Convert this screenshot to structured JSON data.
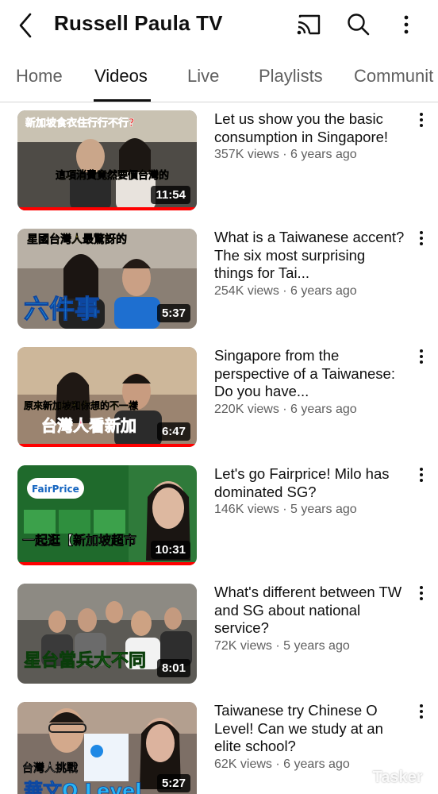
{
  "header": {
    "channel_name": "Russell Paula TV"
  },
  "tabs": [
    {
      "label": "Home"
    },
    {
      "label": "Videos"
    },
    {
      "label": "Live"
    },
    {
      "label": "Playlists"
    },
    {
      "label": "Communit"
    }
  ],
  "videos": [
    {
      "title": "Let us show you the basic consumption in Singapore!",
      "stats": "357K views · 6 years ago",
      "duration": "11:54",
      "overlay_top": "新加坡食衣住行行不行?",
      "overlay_bottom": "這項消費竟然要價台灣的"
    },
    {
      "title": "What is a Taiwanese accent?  The six most surprising things for Tai...",
      "stats": "254K views · 6 years ago",
      "duration": "5:37",
      "overlay_top": "星國台灣人最驚訝的",
      "overlay_bottom": "六件事"
    },
    {
      "title": "Singapore from the perspective of a Taiwanese: Do you have...",
      "stats": "220K views · 6 years ago",
      "duration": "6:47",
      "overlay_top": "原來新加坡和你想的不一樣",
      "overlay_bottom": "台灣人看新加"
    },
    {
      "title": "Let's go Fairprice! Milo has dominated SG?",
      "stats": "146K views · 5 years ago",
      "duration": "10:31",
      "overlay_top": "FairPrice",
      "overlay_bottom": "一起逛【新加坡超市"
    },
    {
      "title": "What's different between TW and SG about national service?",
      "stats": "72K views · 5 years ago",
      "duration": "8:01",
      "overlay_top": "",
      "overlay_bottom": "星台當兵大不同"
    },
    {
      "title": "Taiwanese try Chinese O Level! Can we study at an elite school?",
      "stats": "62K views · 6 years ago",
      "duration": "5:27",
      "overlay_top": "台灣人挑戰",
      "overlay_bottom": "華文O Level"
    }
  ],
  "watermark": "Tasker",
  "colors": {
    "progress": "#ff0000",
    "text_primary": "#0f0f0f",
    "text_secondary": "#606060"
  }
}
